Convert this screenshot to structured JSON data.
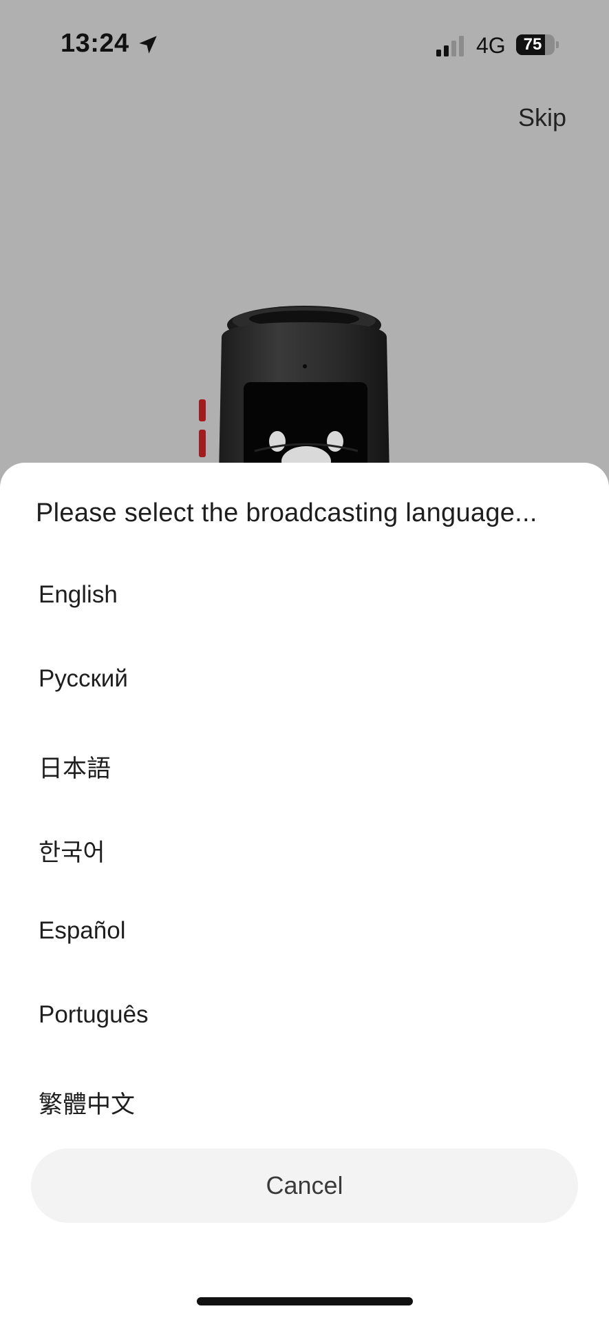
{
  "status_bar": {
    "time": "13:24",
    "network": "4G",
    "battery_level": "75",
    "battery_fraction": 0.75,
    "icons": [
      "location-arrow-icon",
      "signal-bars-icon",
      "battery-icon"
    ]
  },
  "header": {
    "skip_label": "Skip"
  },
  "sheet": {
    "title": "Please select the broadcasting language...",
    "languages": [
      {
        "label": "English"
      },
      {
        "label": "Русский"
      },
      {
        "label": "日本語"
      },
      {
        "label": "한국어"
      },
      {
        "label": "Español"
      },
      {
        "label": "Português"
      },
      {
        "label": "繁體中文"
      }
    ],
    "cancel_label": "Cancel"
  },
  "colors": {
    "backdrop": "#b0b0b0",
    "sheet_background": "#ffffff",
    "cancel_background": "#f3f3f3",
    "text_primary": "#1e1e1e"
  }
}
